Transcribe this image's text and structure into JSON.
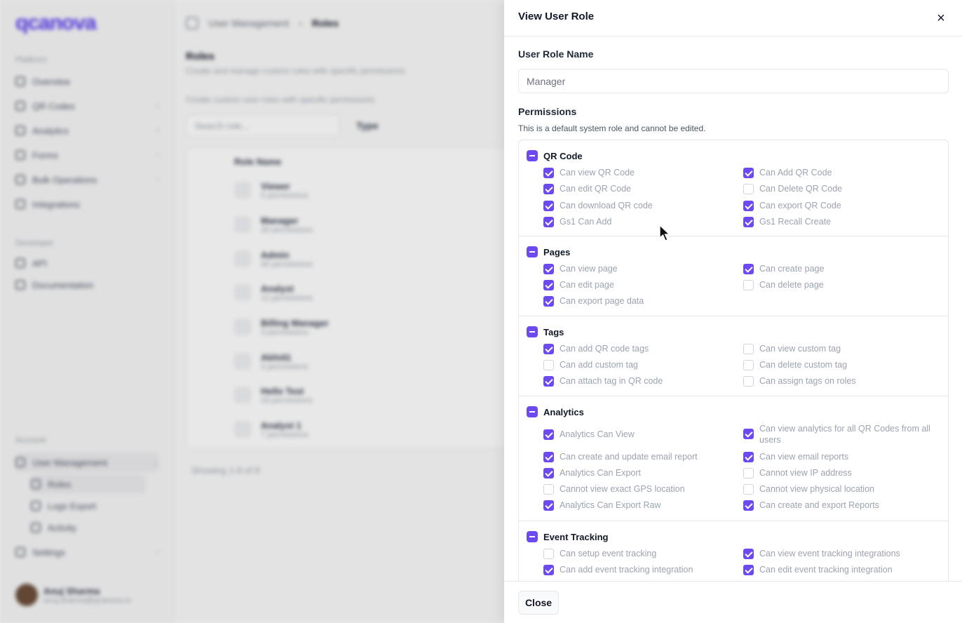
{
  "sidebar": {
    "logo": "qcanova",
    "section_platform": "Platform",
    "platform_items": [
      {
        "label": "Overview"
      },
      {
        "label": "QR Codes"
      },
      {
        "label": "Analytics"
      },
      {
        "label": "Forms"
      },
      {
        "label": "Bulk Operations"
      },
      {
        "label": "Integrations"
      }
    ],
    "section_developer": "Developer",
    "developer_items": [
      {
        "label": "API"
      },
      {
        "label": "Documentation"
      }
    ],
    "section_account": "Account",
    "account_items": [
      {
        "label": "User Management"
      },
      {
        "label": "Roles"
      },
      {
        "label": "Logs Export"
      },
      {
        "label": "Activity"
      },
      {
        "label": "Settings"
      }
    ],
    "user": {
      "name": "Anuj Sharma",
      "email": "anuj.sharma@qcanova.io"
    }
  },
  "main": {
    "breadcrumb_parent": "User Management",
    "breadcrumb_current": "Roles",
    "title": "Roles",
    "subtitle": "Create and manage custom roles with specific permissions",
    "table_desc": "Create custom user roles with specific permissions",
    "search_placeholder": "Search role...",
    "type_filter": "Type",
    "col_role_name": "Role Name",
    "rows": [
      {
        "name": "Viewer",
        "perms": "5 permissions"
      },
      {
        "name": "Manager",
        "perms": "39 permissions"
      },
      {
        "name": "Admin",
        "perms": "66 permissions"
      },
      {
        "name": "Analyst",
        "perms": "12 permissions"
      },
      {
        "name": "Billing Manager",
        "perms": "3 permissions"
      },
      {
        "name": "Abhi41",
        "perms": "3 permissions"
      },
      {
        "name": "Hello Test",
        "perms": "26 permissions"
      },
      {
        "name": "Analyst 1",
        "perms": "7 permissions"
      }
    ],
    "showing": "Showing 1-8 of 8"
  },
  "panel": {
    "title": "View User Role",
    "close_icon": "×",
    "role_name_label": "User Role Name",
    "role_name_value": "Manager",
    "permissions_label": "Permissions",
    "permissions_hint": "This is a default system role and cannot be edited.",
    "accent_color": "#6d4aef",
    "groups": {
      "qr": {
        "title": "QR Code",
        "items": [
          {
            "label": "Can view QR Code",
            "checked": true
          },
          {
            "label": "Can Add QR Code",
            "checked": true
          },
          {
            "label": "Can edit QR Code",
            "checked": true
          },
          {
            "label": "Can Delete QR Code",
            "checked": false
          },
          {
            "label": "Can download QR code",
            "checked": true
          },
          {
            "label": "Can export QR Code",
            "checked": true
          },
          {
            "label": "Gs1 Can Add",
            "checked": true
          },
          {
            "label": "Gs1 Recall Create",
            "checked": true
          }
        ]
      },
      "pages": {
        "title": "Pages",
        "items": [
          {
            "label": "Can view page",
            "checked": true
          },
          {
            "label": "Can create page",
            "checked": true
          },
          {
            "label": "Can edit page",
            "checked": true
          },
          {
            "label": "Can delete page",
            "checked": false
          },
          {
            "label": "Can export page data",
            "checked": true
          }
        ]
      },
      "tags": {
        "title": "Tags",
        "items": [
          {
            "label": "Can add QR code tags",
            "checked": true
          },
          {
            "label": "Can view custom tag",
            "checked": false
          },
          {
            "label": "Can add custom tag",
            "checked": false
          },
          {
            "label": "Can delete custom tag",
            "checked": false
          },
          {
            "label": "Can attach tag in QR code",
            "checked": true
          },
          {
            "label": "Can assign tags on roles",
            "checked": false
          }
        ]
      },
      "analytics": {
        "title": "Analytics",
        "items": [
          {
            "label": "Analytics Can View",
            "checked": true
          },
          {
            "label": "Can view analytics for all QR Codes from all users",
            "checked": true
          },
          {
            "label": "Can create and update email report",
            "checked": true
          },
          {
            "label": "Can view email reports",
            "checked": true
          },
          {
            "label": "Analytics Can Export",
            "checked": true
          },
          {
            "label": "Cannot view IP address",
            "checked": false
          },
          {
            "label": "Cannot view exact GPS location",
            "checked": false
          },
          {
            "label": "Cannot view physical location",
            "checked": false
          },
          {
            "label": "Analytics Can Export Raw",
            "checked": true
          },
          {
            "label": "Can create and export Reports",
            "checked": true
          }
        ]
      },
      "event": {
        "title": "Event Tracking",
        "items": [
          {
            "label": "Can setup event tracking",
            "checked": false
          },
          {
            "label": "Can view event tracking integrations",
            "checked": true
          },
          {
            "label": "Can add event tracking integration",
            "checked": true
          },
          {
            "label": "Can edit event tracking integration",
            "checked": true
          }
        ]
      }
    },
    "close_button": "Close"
  }
}
